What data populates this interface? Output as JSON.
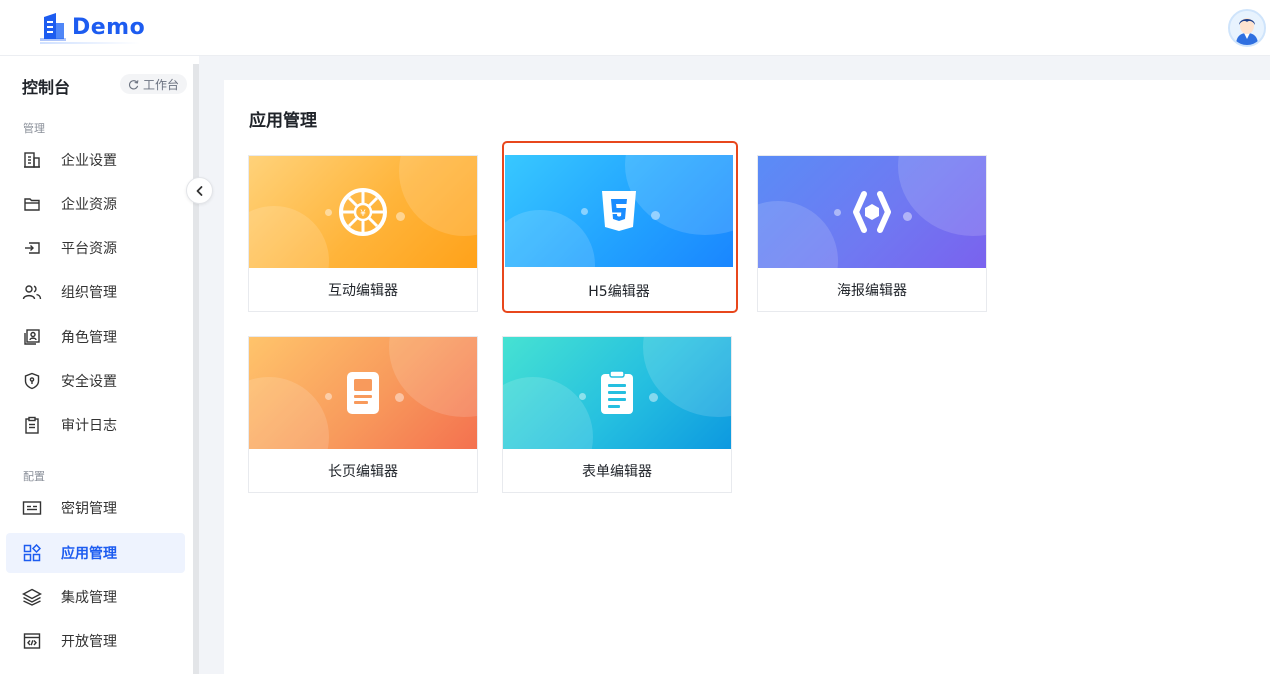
{
  "header": {
    "logo_text": "Demo",
    "colors": {
      "brand": "#1d5cf0"
    }
  },
  "sidebar": {
    "title": "控制台",
    "workbench_label": "工作台",
    "groups": [
      {
        "label": "管理"
      },
      {
        "label": "配置"
      }
    ],
    "items": [
      {
        "label": "企业设置",
        "icon": "building-icon"
      },
      {
        "label": "企业资源",
        "icon": "folder-icon"
      },
      {
        "label": "平台资源",
        "icon": "import-icon"
      },
      {
        "label": "组织管理",
        "icon": "users-icon"
      },
      {
        "label": "角色管理",
        "icon": "user-card-icon"
      },
      {
        "label": "安全设置",
        "icon": "shield-icon"
      },
      {
        "label": "审计日志",
        "icon": "clipboard-icon"
      },
      {
        "label": "密钥管理",
        "icon": "key-card-icon"
      },
      {
        "label": "应用管理",
        "icon": "apps-grid-icon",
        "active": true
      },
      {
        "label": "集成管理",
        "icon": "layers-icon"
      },
      {
        "label": "开放管理",
        "icon": "code-window-icon"
      }
    ]
  },
  "main": {
    "section_title": "应用管理",
    "apps": [
      {
        "label": "互动编辑器",
        "icon": "wheel-icon",
        "gradient": [
          "#ffd27a",
          "#ffa21a"
        ]
      },
      {
        "label": "H5编辑器",
        "icon": "html5-icon",
        "gradient": [
          "#38c8ff",
          "#1a86ff"
        ],
        "selected": true,
        "selection_color": "#e8471c"
      },
      {
        "label": "海报编辑器",
        "icon": "hexagon-code-icon",
        "gradient": [
          "#5a8cf6",
          "#7a62ee"
        ]
      },
      {
        "label": "长页编辑器",
        "icon": "document-icon",
        "gradient": [
          "#ffc46b",
          "#f4714f"
        ]
      },
      {
        "label": "表单编辑器",
        "icon": "form-clipboard-icon",
        "gradient": [
          "#46e2d2",
          "#0d99e0"
        ]
      }
    ]
  }
}
